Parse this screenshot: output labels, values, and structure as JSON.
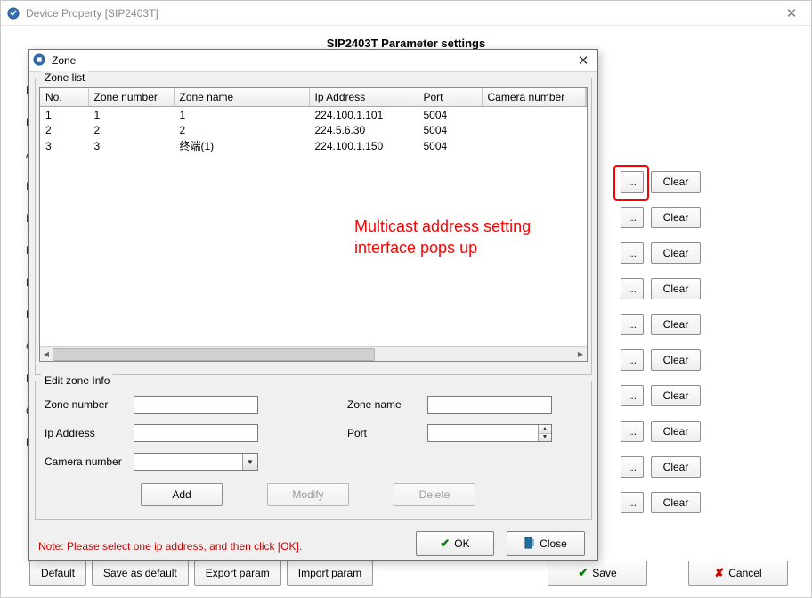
{
  "parent_window": {
    "title": "Device Property [SIP2403T]",
    "heading": "SIP2403T Parameter settings",
    "bottom_buttons": {
      "default": "Default",
      "save_as_default": "Save as default",
      "export_param": "Export param",
      "import_param": "Import param",
      "save": "Save",
      "cancel": "Cancel"
    },
    "side_labels": [
      "R",
      "E",
      "A",
      "Ip",
      "Ir",
      "M",
      "K",
      "M",
      "C",
      "D",
      "G",
      "D"
    ],
    "dots_label": "...",
    "clear_label": "Clear"
  },
  "zone_dialog": {
    "title": "Zone",
    "list_label": "Zone list",
    "columns": {
      "no": "No.",
      "zone_number": "Zone number",
      "zone_name": "Zone name",
      "ip_address": "Ip Address",
      "port": "Port",
      "camera_number": "Camera number"
    },
    "rows": [
      {
        "no": "1",
        "zone_number": "1",
        "zone_name": "1",
        "ip_address": "224.100.1.101",
        "port": "5004",
        "camera_number": ""
      },
      {
        "no": "2",
        "zone_number": "2",
        "zone_name": "2",
        "ip_address": "224.5.6.30",
        "port": "5004",
        "camera_number": ""
      },
      {
        "no": "3",
        "zone_number": "3",
        "zone_name": "终端(1)",
        "ip_address": "224.100.1.150",
        "port": "5004",
        "camera_number": ""
      }
    ],
    "edit_label": "Edit zone Info",
    "fields": {
      "zone_number": "Zone number",
      "zone_name": "Zone name",
      "ip_address": "Ip Address",
      "port": "Port",
      "camera_number": "Camera number"
    },
    "buttons": {
      "add": "Add",
      "modify": "Modify",
      "delete": "Delete",
      "ok": "OK",
      "close": "Close"
    },
    "note": "Note: Please select one ip address, and then click [OK]."
  },
  "annotation": {
    "line1": "Multicast address setting",
    "line2": "interface pops up"
  }
}
